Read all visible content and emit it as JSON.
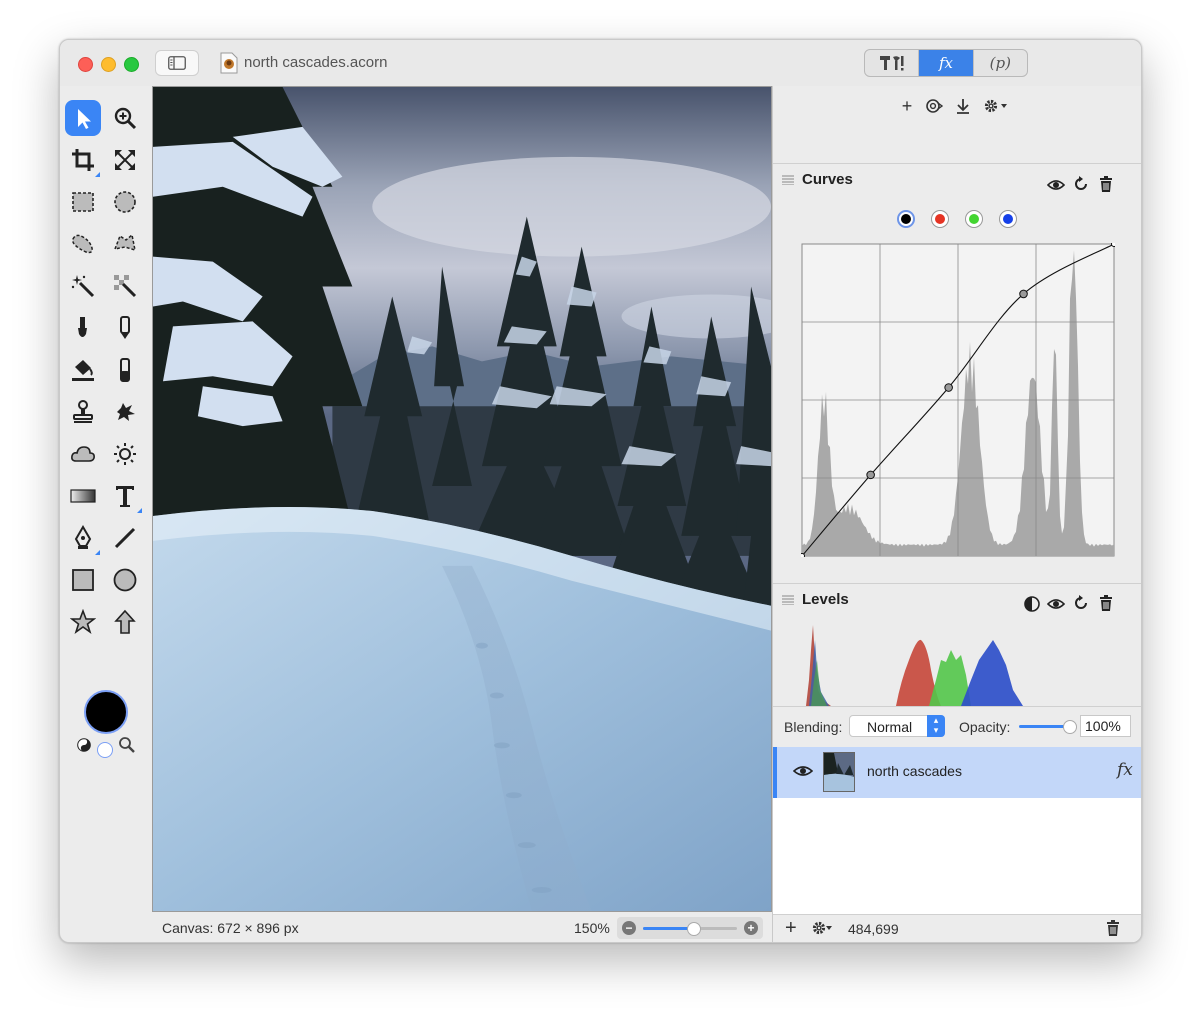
{
  "window": {
    "document_title": "north cascades.acorn",
    "mode_tabs": [
      "T!",
      "fx",
      "(p)"
    ],
    "active_mode": "fx"
  },
  "tools": [
    {
      "name": "move-tool",
      "icon": "arrow-pointer-icon",
      "active": true
    },
    {
      "name": "zoom-tool",
      "icon": "magnifier-plus-icon"
    },
    {
      "name": "crop-tool",
      "icon": "crop-icon"
    },
    {
      "name": "transform-tool",
      "icon": "expand-arrows-icon"
    },
    {
      "name": "rect-select-tool",
      "icon": "dashed-rect-icon"
    },
    {
      "name": "ellipse-select-tool",
      "icon": "dashed-circle-icon"
    },
    {
      "name": "lasso-tool",
      "icon": "lasso-icon"
    },
    {
      "name": "polygon-lasso-tool",
      "icon": "polygon-lasso-icon"
    },
    {
      "name": "magic-wand-tool",
      "icon": "magic-wand-icon"
    },
    {
      "name": "instant-alpha-tool",
      "icon": "checker-wand-icon"
    },
    {
      "name": "brush-tool",
      "icon": "brush-icon"
    },
    {
      "name": "pencil-tool",
      "icon": "pencil-icon"
    },
    {
      "name": "paint-bucket-tool",
      "icon": "paint-bucket-icon"
    },
    {
      "name": "eraser-tool",
      "icon": "eraser-icon"
    },
    {
      "name": "clone-tool",
      "icon": "stamp-icon"
    },
    {
      "name": "smudge-tool",
      "icon": "splatter-icon"
    },
    {
      "name": "shape-tool",
      "icon": "cloud-icon"
    },
    {
      "name": "dodge-tool",
      "icon": "sun-icon"
    },
    {
      "name": "gradient-tool",
      "icon": "gradient-icon"
    },
    {
      "name": "text-tool",
      "icon": "text-t-icon"
    },
    {
      "name": "pen-tool",
      "icon": "pen-nib-icon"
    },
    {
      "name": "line-tool",
      "icon": "line-icon"
    },
    {
      "name": "rectangle-tool",
      "icon": "square-icon"
    },
    {
      "name": "oval-tool",
      "icon": "circle-icon"
    },
    {
      "name": "star-tool",
      "icon": "star-icon"
    },
    {
      "name": "arrow-tool",
      "icon": "up-arrow-icon"
    }
  ],
  "colors": {
    "accent": "#3a85f5",
    "foreground_color": "#000000",
    "background_color": "#ffffff"
  },
  "status": {
    "canvas_size": "Canvas: 672 × 896 px",
    "zoom": "150%",
    "zoom_slider_fraction": 0.53
  },
  "filters_toolbar": {
    "add": "+",
    "icons": [
      "plus-icon",
      "filter-icon",
      "download-icon",
      "gear-dropdown-icon"
    ]
  },
  "curves": {
    "title": "Curves",
    "channels": [
      {
        "name": "rgb",
        "color": "#000000",
        "selected": true
      },
      {
        "name": "red",
        "color": "#e53424"
      },
      {
        "name": "green",
        "color": "#43d531"
      },
      {
        "name": "blue",
        "color": "#1540e8"
      }
    ],
    "points": [
      [
        0,
        0
      ],
      [
        0.22,
        0.26
      ],
      [
        0.47,
        0.54
      ],
      [
        0.71,
        0.84
      ],
      [
        1,
        1
      ]
    ]
  },
  "levels": {
    "title": "Levels"
  },
  "layer_options": {
    "blending_label": "Blending:",
    "blending_value": "Normal",
    "opacity_label": "Opacity:",
    "opacity_value": "100%",
    "opacity_fraction": 1.0
  },
  "layers": [
    {
      "name": "north cascades",
      "visible": true,
      "has_filters": true,
      "fx_label": "fx"
    }
  ],
  "layers_footer": {
    "add": "+",
    "coordinates": "484,699"
  }
}
